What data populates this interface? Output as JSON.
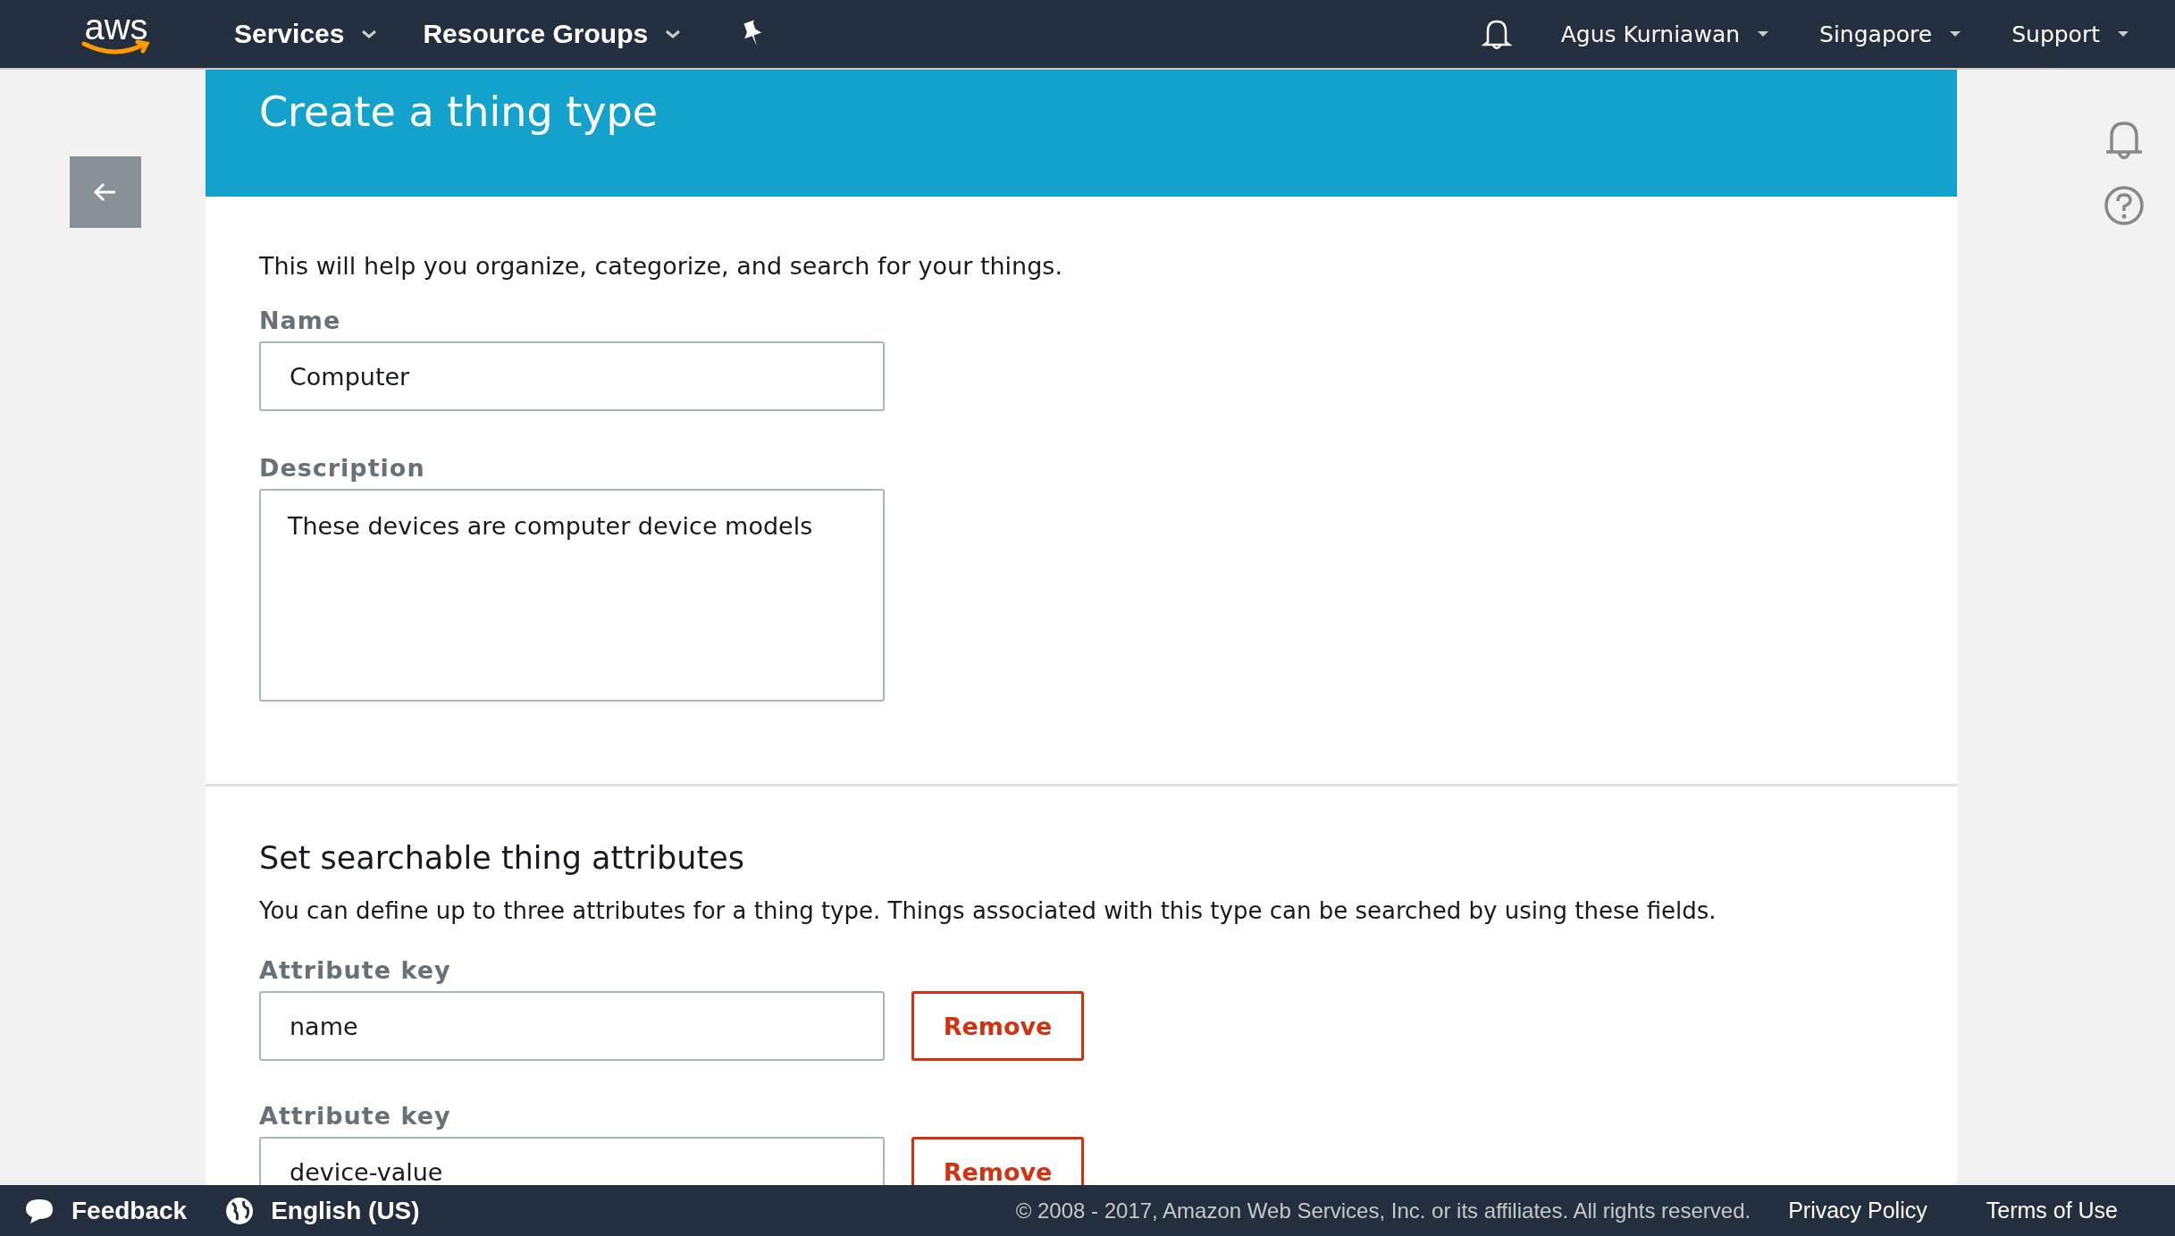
{
  "nav": {
    "logo": "aws",
    "menus": [
      {
        "label": "Services"
      },
      {
        "label": "Resource Groups"
      }
    ],
    "account": [
      {
        "label": "Agus Kurniawan"
      },
      {
        "label": "Singapore"
      },
      {
        "label": "Support"
      }
    ]
  },
  "page": {
    "title": "Create a thing type",
    "intro": "This will help you organize, categorize, and search for your things.",
    "fields": [
      {
        "kind": "input",
        "label": "Name",
        "value": "Computer"
      },
      {
        "kind": "textarea",
        "label": "Description",
        "value": "These devices are computer device models"
      }
    ]
  },
  "attributes": {
    "heading": "Set searchable thing attributes",
    "text": "You can define up to three attributes for a thing type. Things associated with this type can be searched by using these fields.",
    "rows": [
      {
        "label": "Attribute key",
        "value": "name",
        "button": "Remove"
      },
      {
        "label": "Attribute key",
        "value": "device-value",
        "button": "Remove"
      }
    ]
  },
  "footer": {
    "feedback": "Feedback",
    "language": "English (US)",
    "copyright": "© 2008 - 2017, Amazon Web Services, Inc. or its affiliates. All rights reserved.",
    "links": [
      "Privacy Policy",
      "Terms of Use"
    ]
  }
}
